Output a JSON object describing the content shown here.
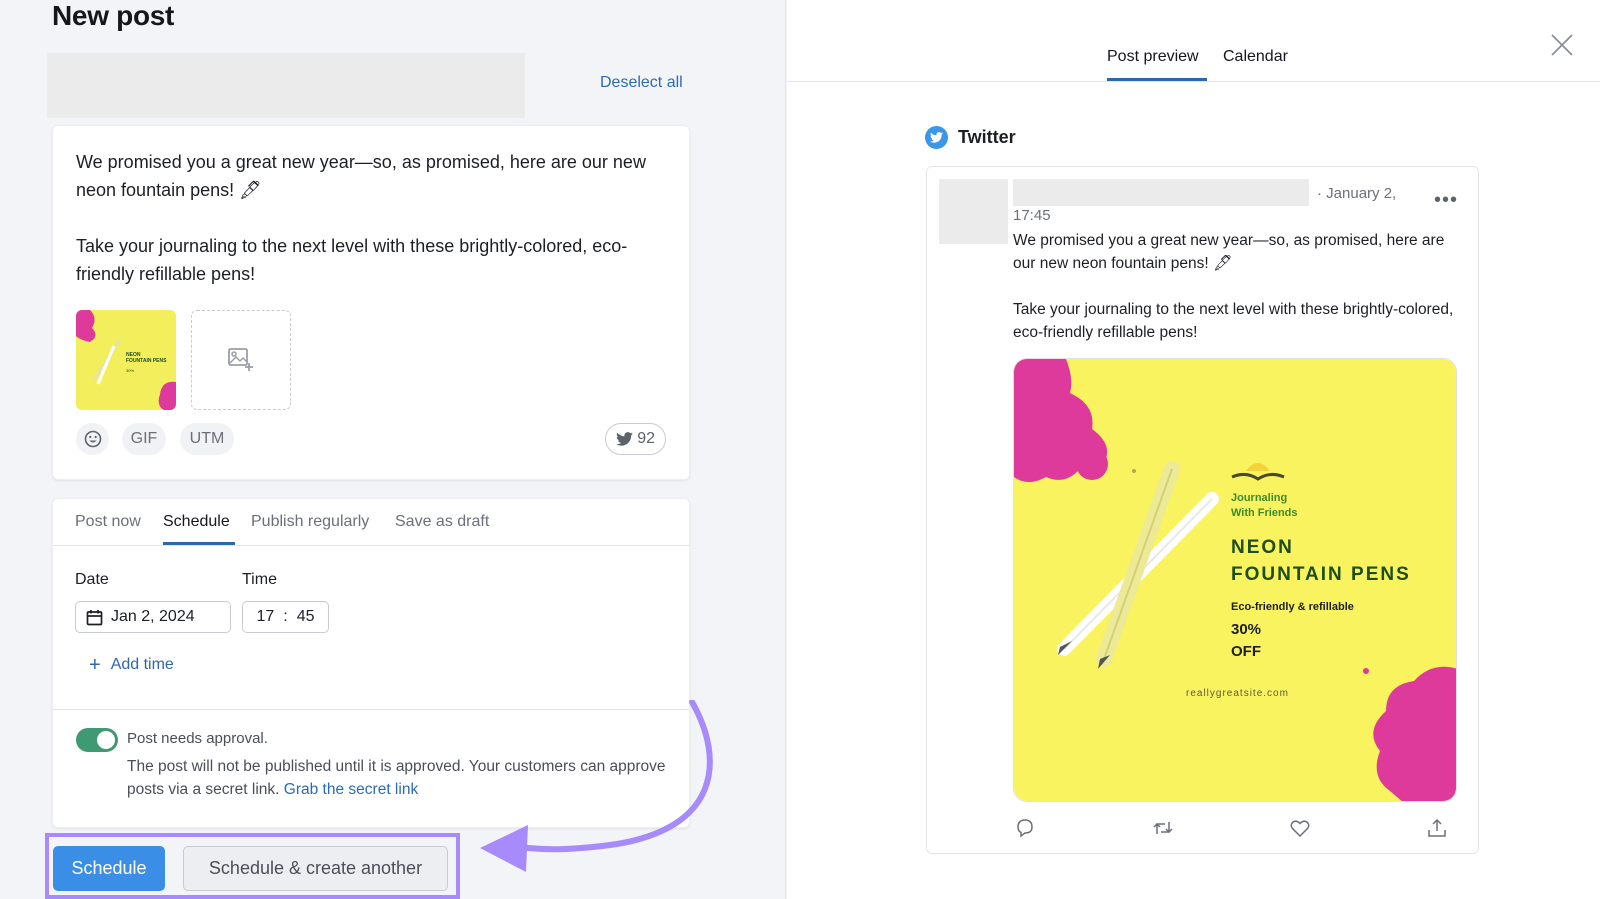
{
  "left": {
    "title": "New post",
    "deselect_label": "Deselect all",
    "post_text": "We promised you a great new year—so, as promised, here are our new neon fountain pens! 🖋\n\nTake your journaling to the next level with these brightly-colored, eco-friendly refillable pens!",
    "chips": {
      "emoji": "emoji-icon",
      "gif": "GIF",
      "utm": "UTM"
    },
    "char_counter": "92",
    "tabs": [
      {
        "label": "Post now"
      },
      {
        "label": "Schedule"
      },
      {
        "label": "Publish regularly"
      },
      {
        "label": "Save as draft"
      }
    ],
    "active_tab": "Schedule",
    "date_label": "Date",
    "time_label": "Time",
    "date_value": "Jan 2, 2024",
    "time_hours": "17",
    "time_sep": ":",
    "time_minutes": "45",
    "add_time_label": "Add time",
    "approval": {
      "enabled": true,
      "title": "Post needs approval.",
      "desc": "The post will not be published until it is approved. Your customers can approve posts via a secret link. ",
      "link": "Grab the secret link"
    },
    "buttons": {
      "primary": "Schedule",
      "secondary": "Schedule & create another"
    }
  },
  "right": {
    "tabs": [
      {
        "label": "Post preview"
      },
      {
        "label": "Calendar"
      }
    ],
    "active_tab": "Post preview",
    "network": "Twitter",
    "tweet": {
      "date": "· January 2,",
      "time": "17:45",
      "more": "•••",
      "text": "We promised you a great new year—so, as promised, here are our new neon fountain pens! 🖋\n\nTake your journaling to the next level with these brightly-colored, eco-friendly refillable pens!"
    },
    "image": {
      "brand_line1": "Journaling",
      "brand_line2": "With Friends",
      "headline1": "NEON",
      "headline2": "FOUNTAIN PENS",
      "tagline": "Eco-friendly & refillable",
      "discount1": "30%",
      "discount2": "OFF",
      "site": "reallygreatsite.com"
    }
  },
  "colors": {
    "accent": "#2f66b0",
    "primary_button": "#3a8ee6",
    "toggle_on": "#3f9a73",
    "twitter": "#3b95e8",
    "annotation": "#a78bfa",
    "poster_yellow": "#f9f35f",
    "poster_pink": "#dd3a9c",
    "poster_green": "#1e4d1e"
  }
}
